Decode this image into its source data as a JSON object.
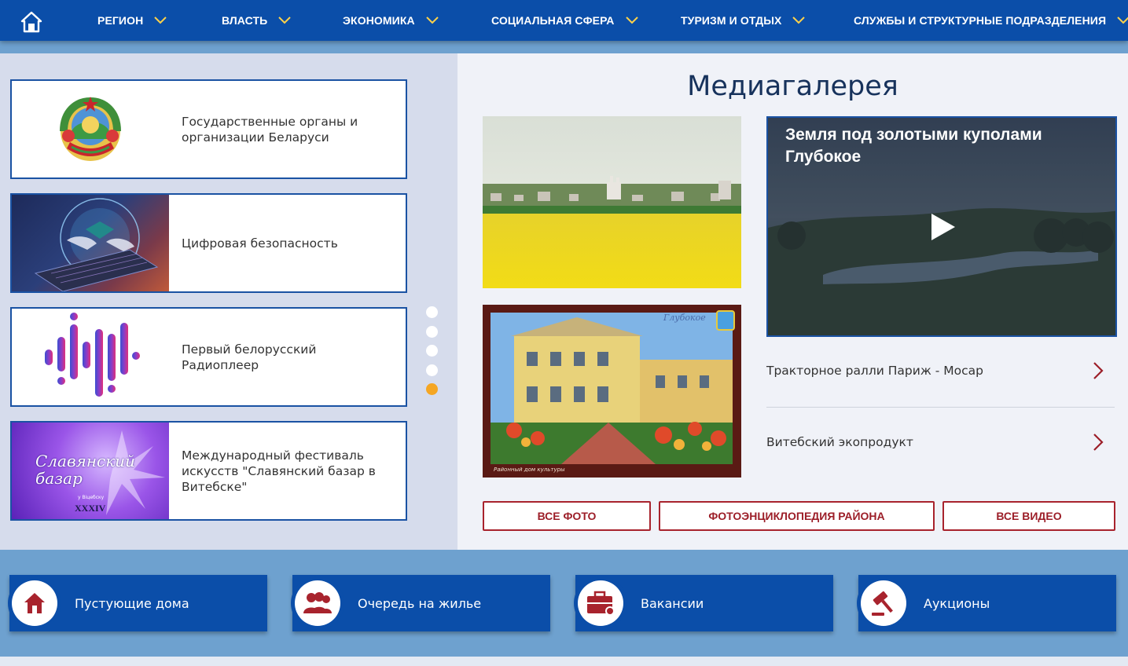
{
  "nav": {
    "home_icon": "home-icon",
    "items": [
      {
        "label": "РЕГИОН"
      },
      {
        "label": "ВЛАСТЬ"
      },
      {
        "label": "ЭКОНОМИКА"
      },
      {
        "label": "СОЦИАЛЬНАЯ СФЕРА"
      },
      {
        "label": "ТУРИЗМ И ОТДЫХ"
      },
      {
        "label": "СЛУЖБЫ И СТРУКТУРНЫЕ ПОДРАЗДЕЛЕНИЯ"
      }
    ]
  },
  "cards": [
    {
      "label": "Государственные органы и организации Беларуси",
      "emblem_text": "РЕСПУБЛІКА БЕЛАРУСЬ"
    },
    {
      "label": "Цифровая безопасность"
    },
    {
      "label": "Первый белорусский Радиоплеер"
    },
    {
      "label": "Международный фестиваль искусств \"Славянский базар в Витебске\"",
      "logo_text": "Славянский базар",
      "logo_sub": "у Віцебску",
      "logo_roman": "XXXIV"
    }
  ],
  "slider": {
    "count": 5,
    "active_index": 4
  },
  "gallery": {
    "title": "Медиагалерея",
    "photo2_caption": "Районный дом культуры",
    "photo2_stamp": "Глубокое",
    "video_title": "Земля под золотыми куполами Глубокое",
    "links": [
      {
        "label": "Тракторное ралли Париж - Мосар"
      },
      {
        "label": "Витебский экопродукт"
      }
    ],
    "buttons": {
      "all_photo": "ВСЕ ФОТО",
      "encyclopedia": "ФОТОЭНЦИКЛОПЕДИЯ РАЙОНА",
      "all_video": "ВСЕ ВИДЕО"
    }
  },
  "services": [
    {
      "label": "Пустующие дома",
      "icon": "house-icon"
    },
    {
      "label": "Очередь на жилье",
      "icon": "people-queue-icon"
    },
    {
      "label": "Вакансии",
      "icon": "briefcase-icon"
    },
    {
      "label": "Аукционы",
      "icon": "gavel-icon"
    }
  ],
  "colors": {
    "nav_bg": "#0b4ea9",
    "accent_red": "#a8232d",
    "dot_active": "#f5a623"
  }
}
